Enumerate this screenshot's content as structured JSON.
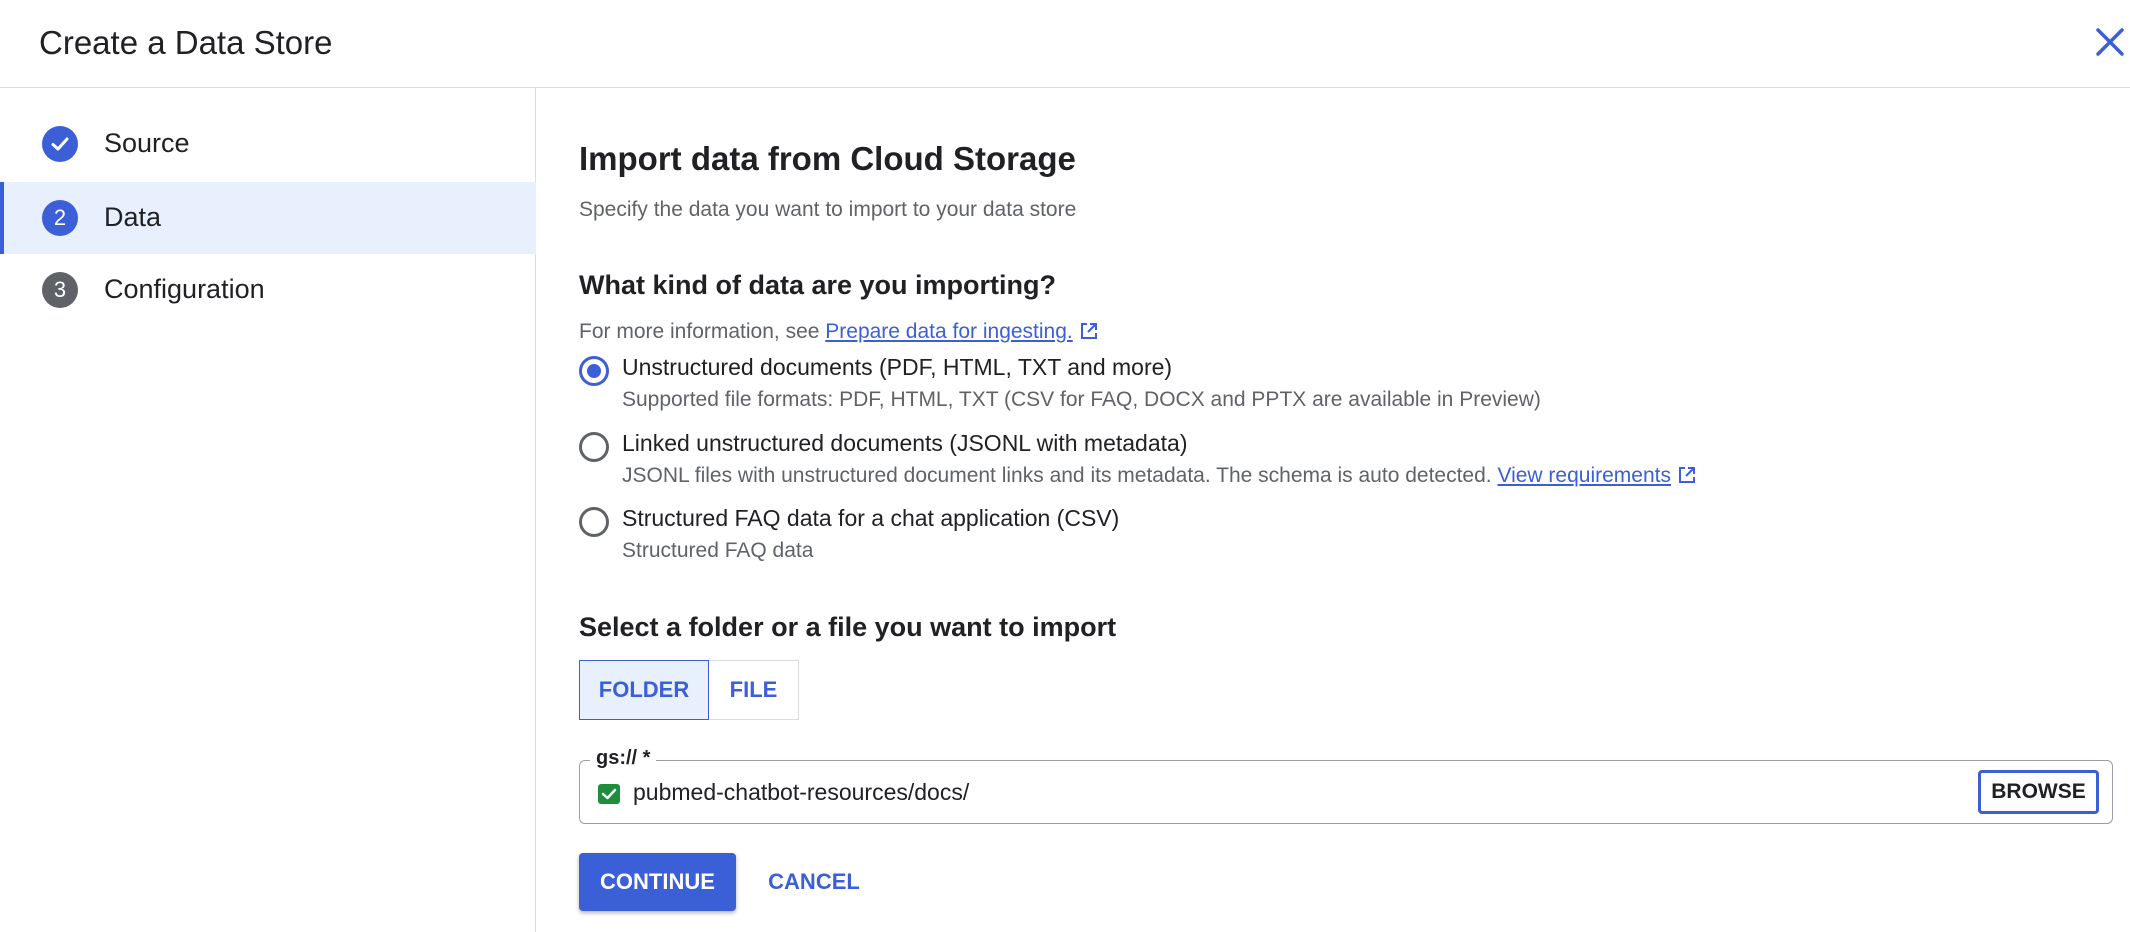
{
  "header": {
    "title": "Create a Data Store"
  },
  "sidebar": {
    "steps": [
      {
        "label": "Source",
        "state": "complete"
      },
      {
        "number": "2",
        "label": "Data",
        "state": "active"
      },
      {
        "number": "3",
        "label": "Configuration",
        "state": "pending"
      }
    ]
  },
  "main": {
    "title": "Import data from Cloud Storage",
    "subtitle": "Specify the data you want to import to your data store",
    "kind_heading": "What kind of data are you importing?",
    "info_prefix": "For more information, see ",
    "info_link": "Prepare data for ingesting.",
    "options": [
      {
        "title": "Unstructured documents (PDF, HTML, TXT and more)",
        "desc": "Supported file formats: PDF, HTML, TXT (CSV for FAQ, DOCX and PPTX are available in Preview)",
        "checked": true
      },
      {
        "title": "Linked unstructured documents (JSONL with metadata)",
        "desc": "JSONL files with unstructured document links and its metadata. The schema is auto detected. ",
        "link": "View requirements",
        "checked": false
      },
      {
        "title": "Structured FAQ data for a chat application (CSV)",
        "desc": "Structured FAQ data",
        "checked": false
      }
    ],
    "select_heading": "Select a folder or a file you want to import",
    "toggle": {
      "folder": "FOLDER",
      "file": "FILE",
      "selected": "folder"
    },
    "field": {
      "label": "gs:// *",
      "value": "pubmed-chatbot-resources/docs/",
      "browse": "BROWSE"
    },
    "actions": {
      "continue": "CONTINUE",
      "cancel": "CANCEL"
    }
  },
  "colors": {
    "accent": "#3b5fd6",
    "active_bg": "#e8f0fe",
    "success": "#1e8e3e",
    "muted": "#5f6368"
  }
}
